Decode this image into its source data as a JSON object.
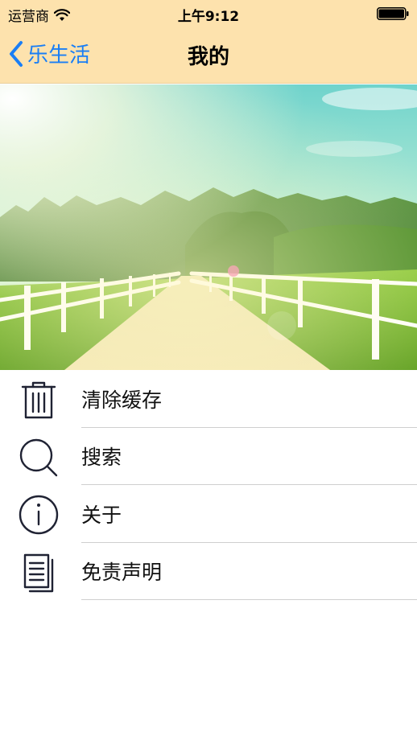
{
  "status_bar": {
    "carrier": "运营商",
    "time": "上午9:12"
  },
  "nav": {
    "back_label": "乐生活",
    "title": "我的"
  },
  "menu": [
    {
      "label": "清除缓存",
      "icon": "trash-icon"
    },
    {
      "label": "搜索",
      "icon": "search-icon"
    },
    {
      "label": "关于",
      "icon": "info-icon"
    },
    {
      "label": "免责声明",
      "icon": "document-icon"
    }
  ],
  "colors": {
    "header_bg": "#fde2ad",
    "accent": "#1a7ef5",
    "icon": "#1f2233"
  }
}
